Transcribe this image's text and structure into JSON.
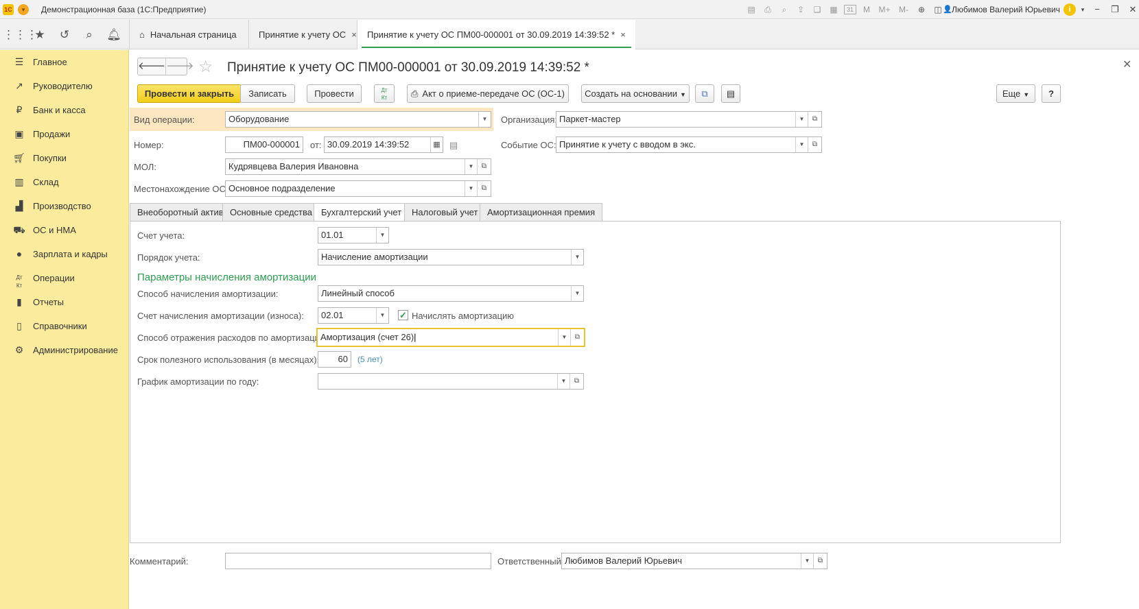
{
  "window": {
    "app_title": "Демонстрационная база  (1С:Предприятие)",
    "user": "Любимов Валерий Юрьевич",
    "toolbar_icons": [
      "save-icon",
      "print-icon",
      "preview-icon",
      "upload-icon",
      "copy-icon",
      "calculator-icon",
      "calendar-icon",
      "M",
      "M+",
      "M-",
      "zoom-icon",
      "panel-icon"
    ],
    "calendar_day": "31",
    "m": "M",
    "m_plus": "M+",
    "m_minus": "M-"
  },
  "tabs": [
    {
      "label": "Начальная страница"
    },
    {
      "label": "Принятие к учету ОС",
      "close": "×"
    },
    {
      "label": "Принятие к учету ОС ПМ00-000001 от 30.09.2019 14:39:52 *",
      "close": "×"
    }
  ],
  "sidebar": {
    "items": [
      {
        "label": "Главное",
        "icon": "menu-icon"
      },
      {
        "label": "Руководителю",
        "icon": "trend-icon"
      },
      {
        "label": "Банк и касса",
        "icon": "ruble-icon"
      },
      {
        "label": "Продажи",
        "icon": "bag-icon"
      },
      {
        "label": "Покупки",
        "icon": "cart-icon"
      },
      {
        "label": "Склад",
        "icon": "warehouse-icon"
      },
      {
        "label": "Производство",
        "icon": "factory-icon"
      },
      {
        "label": "ОС и НМА",
        "icon": "truck-icon"
      },
      {
        "label": "Зарплата и кадры",
        "icon": "person-icon"
      },
      {
        "label": "Операции",
        "icon": "dt-kt-icon"
      },
      {
        "label": "Отчеты",
        "icon": "chart-icon"
      },
      {
        "label": "Справочники",
        "icon": "book-icon"
      },
      {
        "label": "Администрирование",
        "icon": "gear-icon"
      }
    ]
  },
  "form": {
    "title": "Принятие к учету ОС ПМ00-000001 от 30.09.2019 14:39:52 *",
    "buttons": {
      "post_close": "Провести и закрыть",
      "save": "Записать",
      "post": "Провести",
      "print_act": "Акт о приеме-передаче ОС (ОС-1)",
      "create_based": "Создать на основании",
      "more": "Еще",
      "help": "?"
    },
    "dtkt_top": "Дт",
    "dtkt_bottom": "Кт",
    "fields": {
      "op_type_label": "Вид операции:",
      "op_type": "Оборудование",
      "number_label": "Номер:",
      "number": "ПМ00-000001",
      "date_label": "от:",
      "date": "30.09.2019 14:39:52",
      "mol_label": "МОЛ:",
      "mol": "Кудрявцева Валерия Ивановна",
      "location_label": "Местонахождение ОС:",
      "location": "Основное подразделение",
      "org_label": "Организация:",
      "org": "Паркет-мастер",
      "event_label": "Событие ОС:",
      "event": "Принятие к учету с вводом в экс."
    },
    "inner_tabs": [
      "Внеоборотный актив",
      "Основные средства",
      "Бухгалтерский учет",
      "Налоговый учет",
      "Амортизационная премия"
    ],
    "accounting": {
      "account_label": "Счет учета:",
      "account": "01.01",
      "order_label": "Порядок учета:",
      "order": "Начисление амортизации",
      "params_title": "Параметры начисления амортизации",
      "method_label": "Способ начисления амортизации:",
      "method": "Линейный способ",
      "depr_account_label": "Счет начисления амортизации (износа):",
      "depr_account": "02.01",
      "accrue_checkbox_label": "Начислять амортизацию",
      "accrue_checked": true,
      "expense_label": "Способ отражения расходов по амортизации:",
      "expense": "Амортизация (счет 26)",
      "life_label": "Срок полезного использования (в месяцах):",
      "life": "60",
      "life_years": "(5 лет)",
      "schedule_label": "График амортизации по году:",
      "schedule": ""
    },
    "footer": {
      "comment_label": "Комментарий:",
      "comment": "",
      "responsible_label": "Ответственный:",
      "responsible": "Любимов Валерий Юрьевич"
    }
  }
}
